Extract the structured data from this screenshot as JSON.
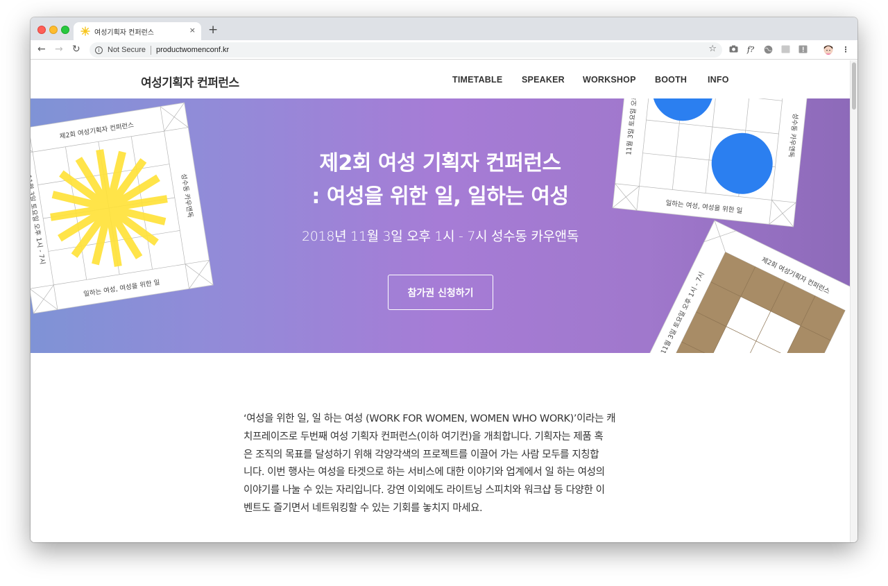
{
  "browser": {
    "tab_title": "여성기획자 컨퍼런스",
    "tab_close": "×",
    "new_tab": "+",
    "security_label": "Not Secure",
    "url": "productwomenconf.kr"
  },
  "site": {
    "brand": "여성기획자 컨퍼런스",
    "menu": [
      "TIMETABLE",
      "SPEAKER",
      "WORKSHOP",
      "BOOTH",
      "INFO"
    ]
  },
  "hero": {
    "title_line1": "제2회 여성 기획자 컨퍼런스",
    "title_line2": ": 여성을 위한 일, 일하는 여성",
    "subtitle": "2018년 11월 3일 오후 1시 - 7시 성수동 카우앤독",
    "cta_label": "참가권 신청하기",
    "left_paper": {
      "top": "제2회 여성기획자 컨퍼런스",
      "right": "성수동 카우앤독",
      "bottom": "일하는 여성, 여성을 위한 일",
      "left": "11월 3일 토요일 오후 1시 - 7시"
    },
    "right_paper": {
      "left": "11월 3일 토요일 오후 1시",
      "right": "성수동 카우앤독",
      "bottom": "일하는 여성, 여성을 위한 일"
    },
    "bottom_paper": {
      "left": "11월 3일 토요일 오후 1시 - 7시",
      "top": "제2회 여성기획자 컨퍼런스"
    },
    "colors": {
      "accent_yellow": "#ffe23a",
      "accent_blue": "#2b7ff0",
      "accent_brown": "#a88c66"
    }
  },
  "intro": {
    "lines": [
      "‘여성을 위한 일, 일 하는 여성 (WORK FOR WOMEN, WOMEN WHO WORK)’이라는 캐",
      "치프레이즈로 두번째 여성 기획자 컨퍼런스(이하 여기컨)을 개최합니다. 기획자는 제품 혹",
      "은 조직의 목표를 달성하기 위해 각양각색의 프로젝트를 이끌어 가는 사람 모두를 지칭합",
      "니다. 이번 행사는 여성을 타겟으로 하는 서비스에 대한 이야기와 업계에서 일 하는 여성의",
      "이야기를 나눌 수 있는 자리입니다. 강연 이외에도 라이트닝 스피치와 워크샵 등 다양한 이",
      "벤트도 즐기면서 네트워킹할 수 있는 기회를 놓치지 마세요."
    ]
  }
}
